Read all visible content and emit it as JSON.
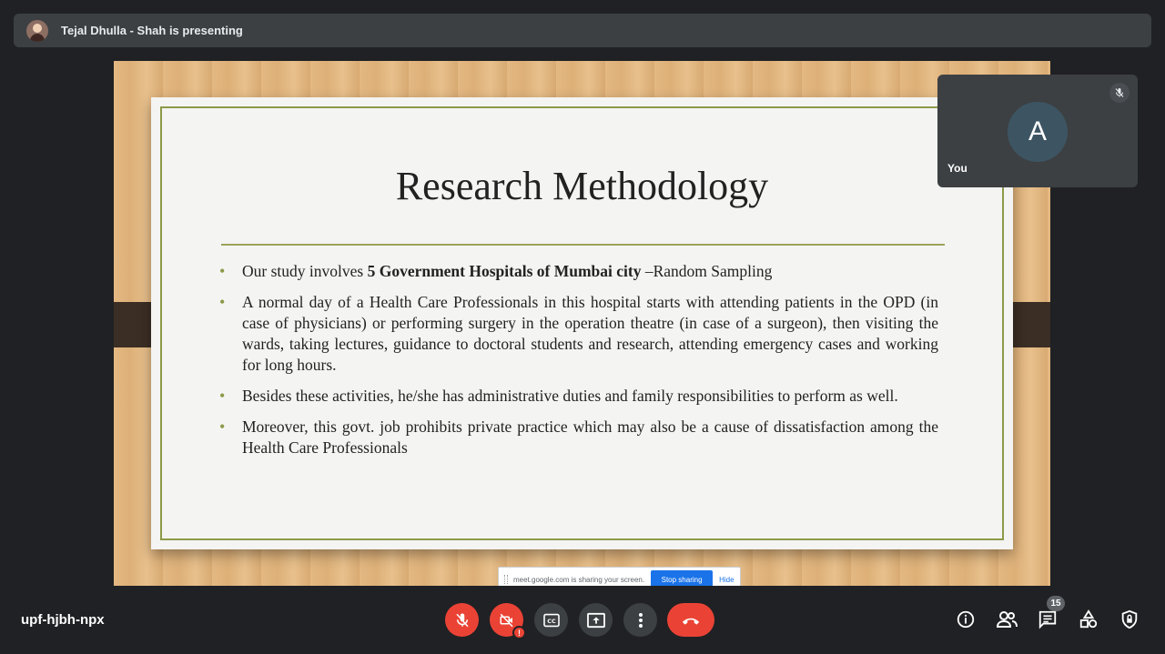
{
  "presenter": {
    "text": "Tejal Dhulla - Shah is presenting"
  },
  "slide": {
    "title": "Research Methodology",
    "bullets": [
      {
        "pre": "Our study involves ",
        "bold": "5 Government Hospitals of Mumbai city",
        "post": " –Random Sampling"
      },
      {
        "text": "A normal day of a Health Care Professionals in this hospital starts with attending patients in the OPD (in case of  physicians) or performing surgery in the operation  theatre  (in  case  of  a surgeon), then visiting the wards, taking lectures, guidance to doctoral students and research, attending emergency cases and working for long hours."
      },
      {
        "text": "Besides these activities, he/she has administrative duties and family responsibilities to perform as well."
      },
      {
        "text": "Moreover, this govt. job prohibits private practice which may also be a cause of dissatisfaction among the Health Care Professionals"
      }
    ]
  },
  "share_banner": {
    "text": "meet.google.com is sharing your screen.",
    "stop_label": "Stop sharing",
    "hide_label": "Hide"
  },
  "self_tile": {
    "initial": "A",
    "name": "You"
  },
  "meeting": {
    "code": "upf-hjbh-npx"
  },
  "controls": {
    "mic": {
      "icon": "mic-off-icon"
    },
    "camera": {
      "icon": "camera-off-icon",
      "alert": "!"
    },
    "captions": {
      "icon": "captions-icon"
    },
    "present": {
      "icon": "present-screen-icon"
    },
    "more": {
      "icon": "more-vert-icon"
    },
    "end_call": {
      "icon": "call-end-icon"
    }
  },
  "side_controls": {
    "people_count": "15",
    "icons": [
      "info-icon",
      "people-icon",
      "chat-icon",
      "activities-icon",
      "host-controls-icon"
    ]
  },
  "colors": {
    "accent_red": "#ea4335",
    "accent_blue": "#1a73e8",
    "background": "#202124"
  }
}
